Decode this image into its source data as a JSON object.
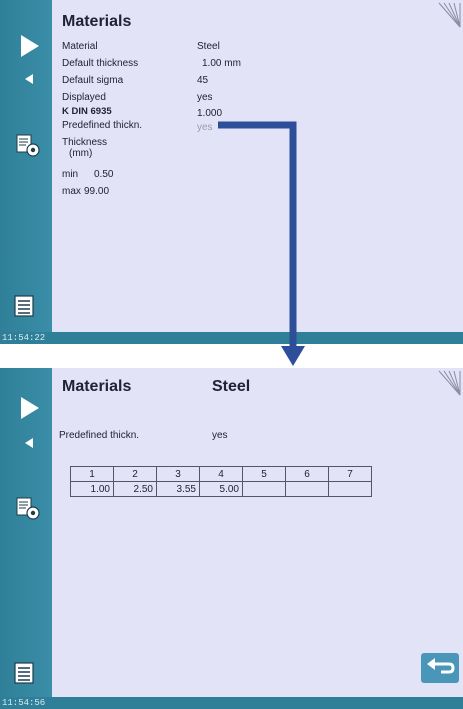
{
  "top_screen": {
    "title": "Materials",
    "rows": [
      {
        "label": "Material",
        "value": "Steel"
      },
      {
        "label": "Default thickness",
        "value": "1.00  mm"
      },
      {
        "label": "Default sigma",
        "value": "45"
      },
      {
        "label": "Displayed",
        "value": "yes"
      },
      {
        "label": "K  DIN  6935",
        "value": "1.000"
      },
      {
        "label": "Predefined  thickn.",
        "value": "yes"
      }
    ],
    "thickness_label_line1": "Thickness",
    "thickness_label_line2": "(mm)",
    "min_label": "min",
    "min_value": "0.50",
    "max_label": "max",
    "max_value": "99.00",
    "clock": "11:54:22"
  },
  "bottom_screen": {
    "title": "Materials",
    "material": "Steel",
    "predefined_label": "Predefined thickn.",
    "predefined_value": "yes",
    "table_headers": [
      "1",
      "2",
      "3",
      "4",
      "5",
      "6",
      "7"
    ],
    "table_values": [
      "1.00",
      "2.50",
      "3.55",
      "5.00",
      "",
      "",
      ""
    ],
    "clock": "11:54:56"
  },
  "colors": {
    "sidebar": "#2f7f98",
    "content_bg": "#e3e3f8",
    "connector_arrow": "#2d4f9a",
    "back_button": "#4a96b8"
  },
  "icons": {
    "sidebar": [
      "play-icon",
      "back-small-icon",
      "settings-doc-icon",
      "list-icon"
    ],
    "corner": "fan-corner-icon",
    "back_button": "return-arrow-icon"
  }
}
